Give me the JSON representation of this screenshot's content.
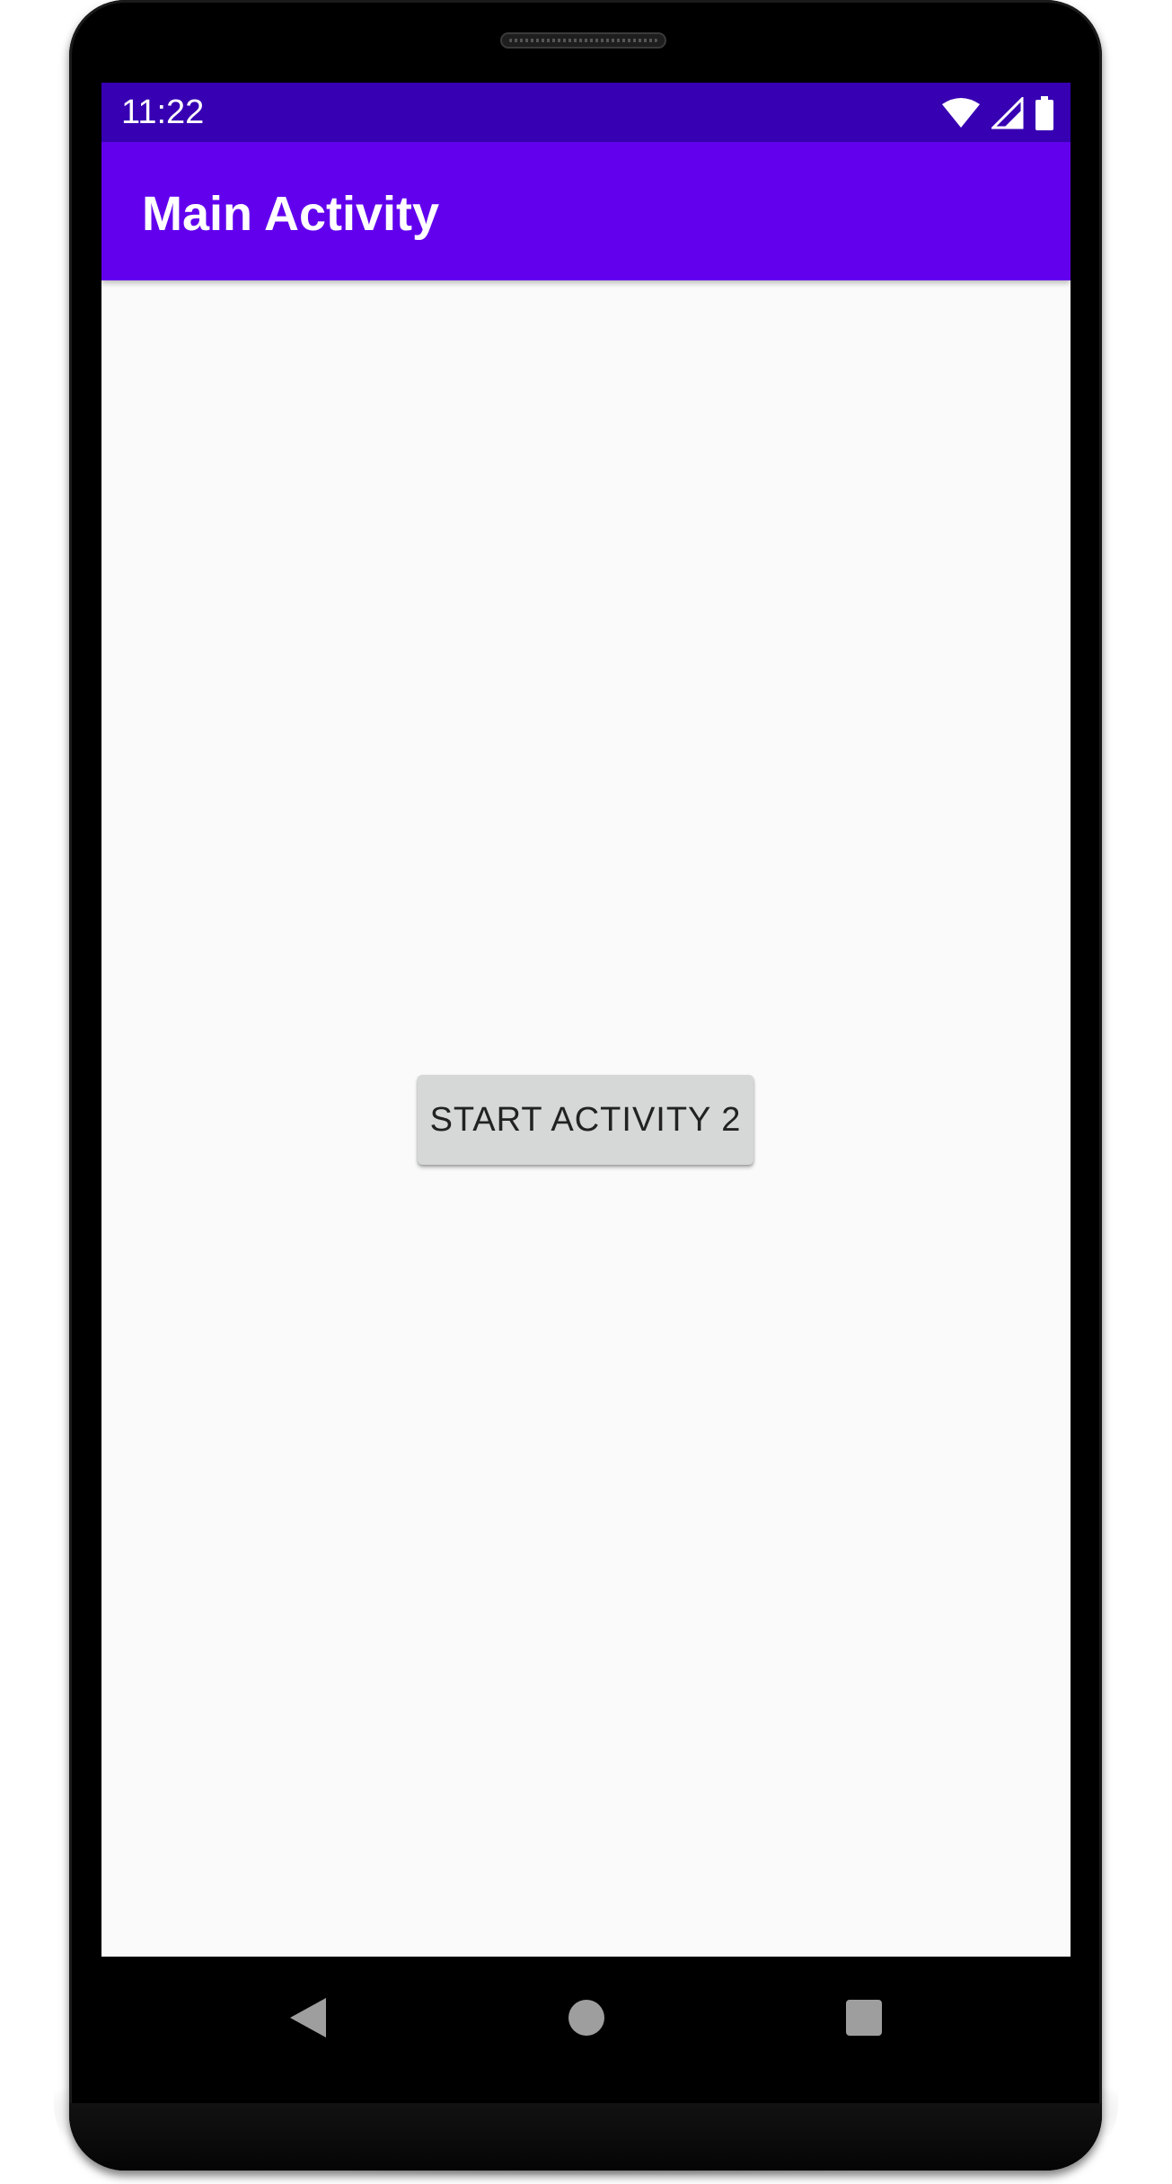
{
  "status_bar": {
    "time": "11:22",
    "icons": [
      "wifi-icon",
      "signal-icon",
      "battery-icon"
    ],
    "color": "#3700b3"
  },
  "app_bar": {
    "title": "Main Activity",
    "color": "#6200ee"
  },
  "main": {
    "start_button_label": "START ACTIVITY 2"
  },
  "nav_bar": {
    "buttons": [
      "back-icon",
      "home-icon",
      "recents-icon"
    ]
  }
}
